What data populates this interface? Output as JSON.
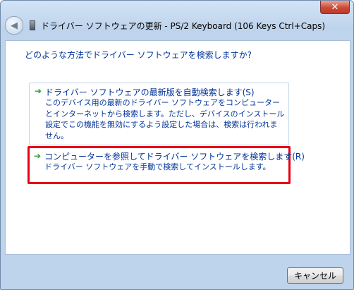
{
  "window": {
    "title": "ドライバー ソフトウェアの更新 - PS/2 Keyboard (106 Keys Ctrl+Caps)",
    "close_label": "✕",
    "back_label": "◀"
  },
  "main": {
    "question": "どのような方法でドライバー ソフトウェアを検索しますか?",
    "options": [
      {
        "title": "ドライバー ソフトウェアの最新版を自動検索します(S)",
        "description": "このデバイス用の最新のドライバー ソフトウェアをコンピューターとインターネットから検索します。ただし、デバイスのインストール設定でこの機能を無効にするよう設定した場合は、検索は行われません。",
        "highlighted": false
      },
      {
        "title": "コンピューターを参照してドライバー ソフトウェアを検索します(R)",
        "description": "ドライバー ソフトウェアを手動で検索してインストールします。",
        "highlighted": true
      }
    ],
    "arrow_glyph": "➔"
  },
  "footer": {
    "cancel_label": "キャンセル"
  },
  "colors": {
    "link_text": "#003399",
    "highlight_border": "#e60012",
    "arrow": "#23a334"
  }
}
